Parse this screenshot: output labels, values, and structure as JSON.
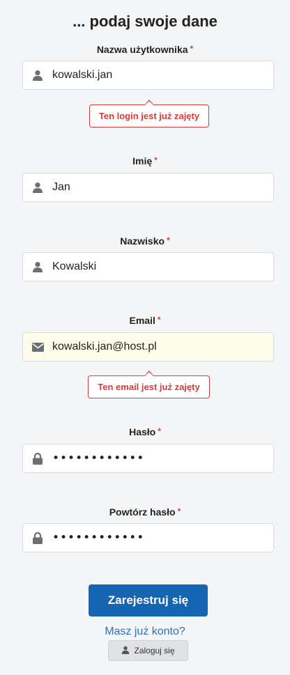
{
  "header": {
    "title": "... podaj swoje dane"
  },
  "required_mark": "*",
  "fields": {
    "username": {
      "label": "Nazwa użytkownika",
      "value": "kowalski.jan",
      "icon": "user-icon",
      "error": "Ten login jest już zajęty"
    },
    "first_name": {
      "label": "Imię",
      "value": "Jan",
      "icon": "user-icon"
    },
    "last_name": {
      "label": "Nazwisko",
      "value": "Kowalski",
      "icon": "user-icon"
    },
    "email": {
      "label": "Email",
      "value": "kowalski.jan@host.pl",
      "icon": "envelope-icon",
      "error": "Ten email jest już zajęty"
    },
    "password": {
      "label": "Hasło",
      "value": "••••••••••••",
      "icon": "lock-icon"
    },
    "password_repeat": {
      "label": "Powtórz hasło",
      "value": "••••••••••••",
      "icon": "lock-icon"
    }
  },
  "actions": {
    "submit_label": "Zarejestruj się",
    "have_account_label": "Masz już konto?",
    "login_label": "Zaloguj się",
    "login_icon": "user-icon"
  },
  "colors": {
    "accent": "#1565b2",
    "error": "#d63a3a",
    "link": "#2e6fba",
    "autofill": "#fdfde9"
  }
}
